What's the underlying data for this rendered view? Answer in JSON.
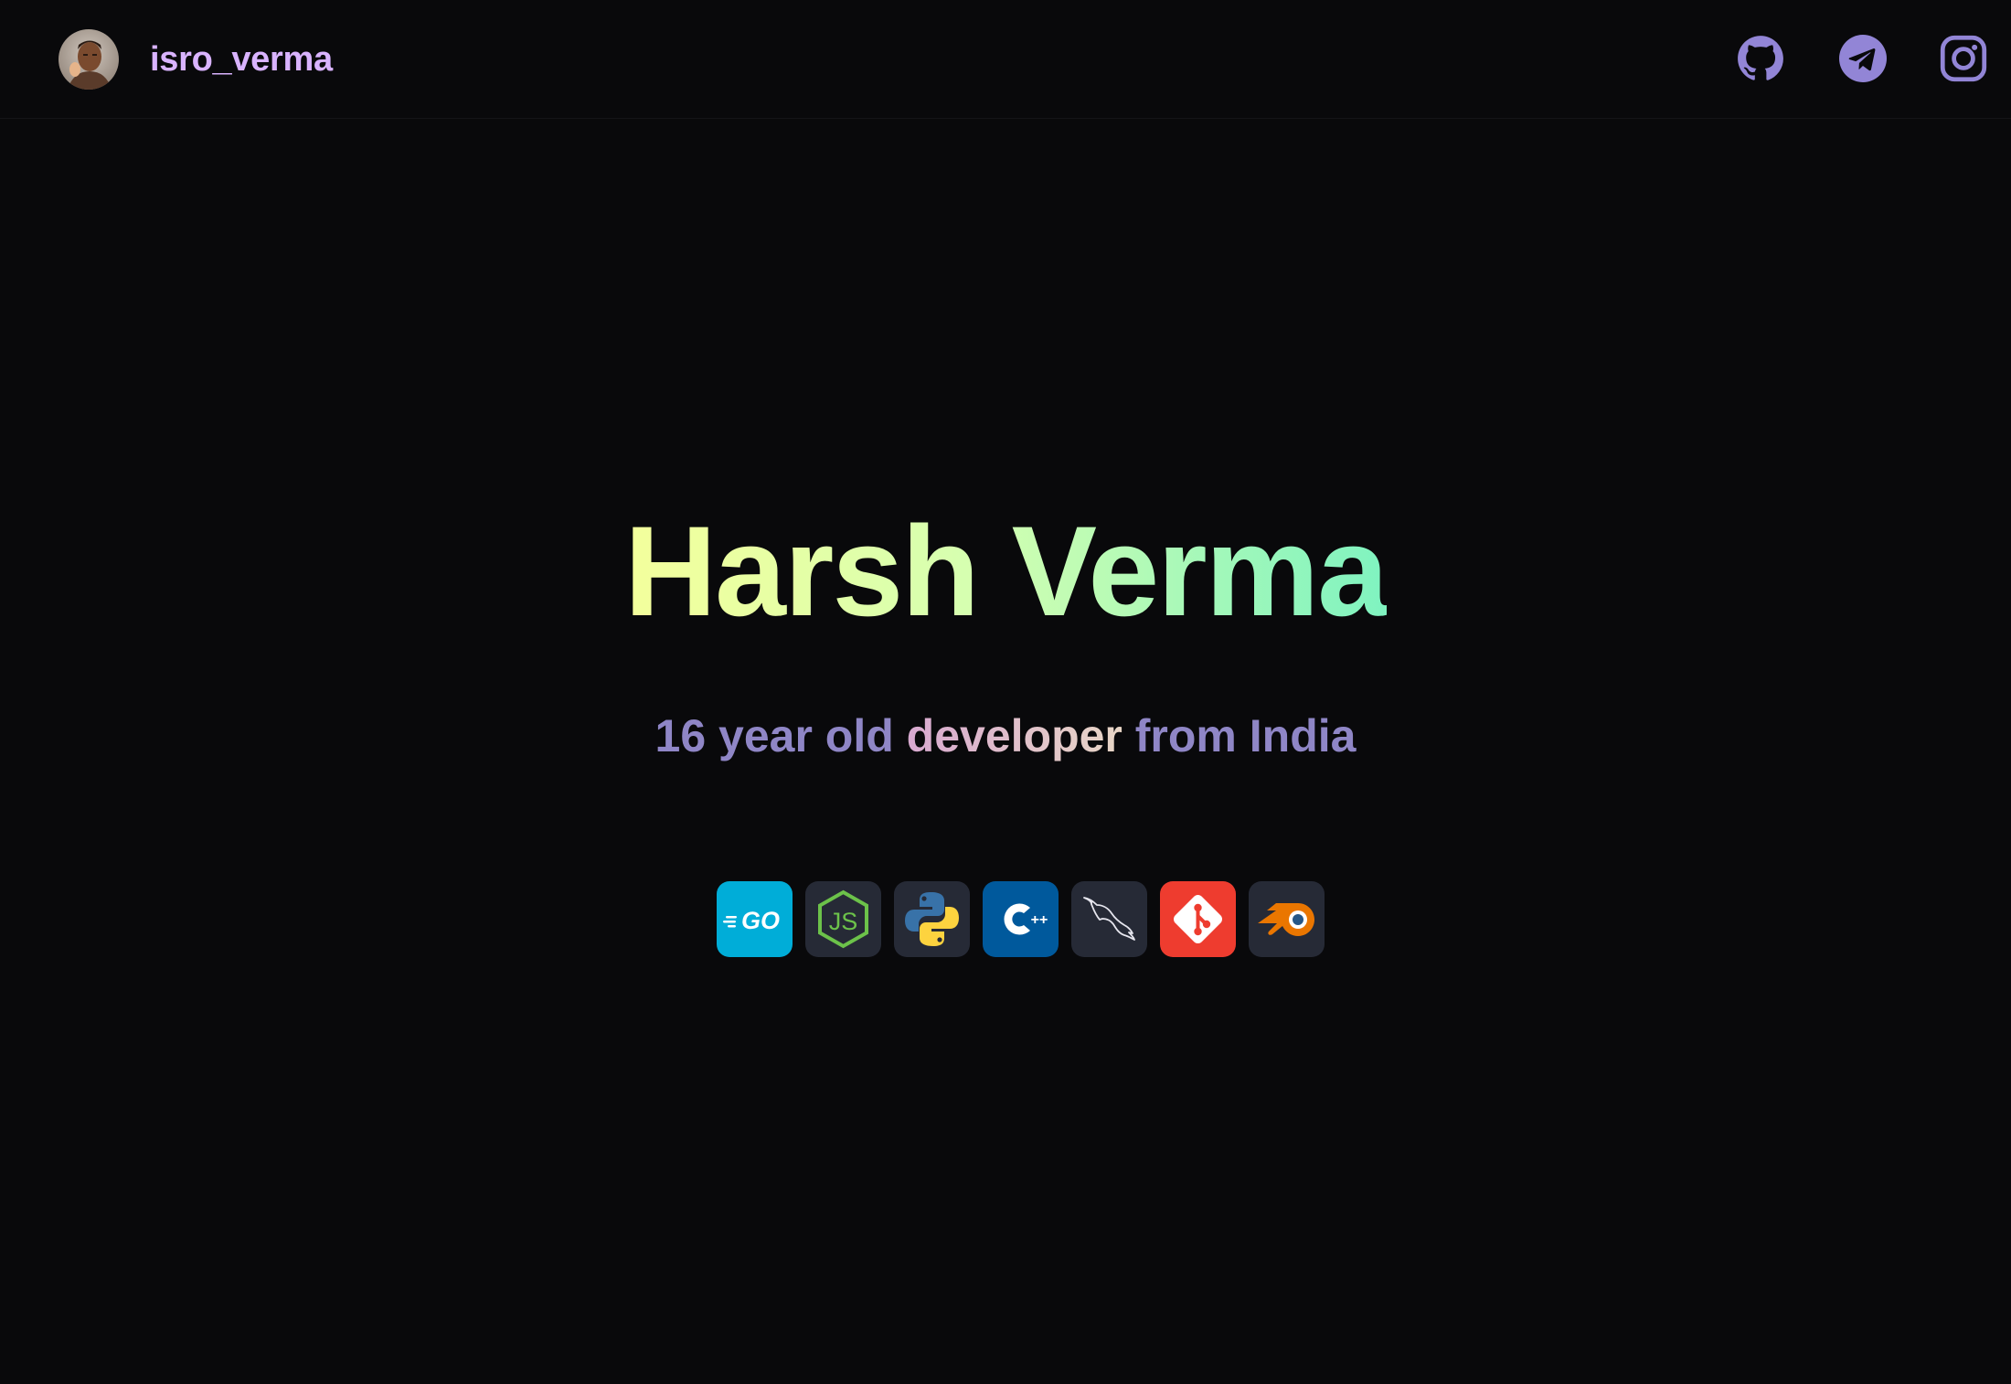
{
  "header": {
    "username": "isro_verma",
    "social": [
      {
        "name": "github",
        "icon": "github-icon"
      },
      {
        "name": "telegram",
        "icon": "telegram-icon"
      },
      {
        "name": "instagram",
        "icon": "instagram-icon"
      }
    ]
  },
  "hero": {
    "title": "Harsh Verma",
    "tagline_pre": "16 year old ",
    "tagline_highlight": "developer",
    "tagline_post": " from India"
  },
  "tech_stack": {
    "items": [
      {
        "icon": "go-icon",
        "label": "GO"
      },
      {
        "icon": "nodejs-icon",
        "label": "JS"
      },
      {
        "icon": "python-icon"
      },
      {
        "icon": "cpp-icon",
        "label": "++"
      },
      {
        "icon": "mysql-icon"
      },
      {
        "icon": "git-icon"
      },
      {
        "icon": "blender-icon"
      }
    ]
  },
  "colors": {
    "background": "#09090b",
    "username": "#d9b3ff",
    "social_icons": "#9285d6",
    "title_gradient_start": "#f4ff9c",
    "title_gradient_end": "#7ff3c0",
    "tagline": "#8f86c6"
  }
}
